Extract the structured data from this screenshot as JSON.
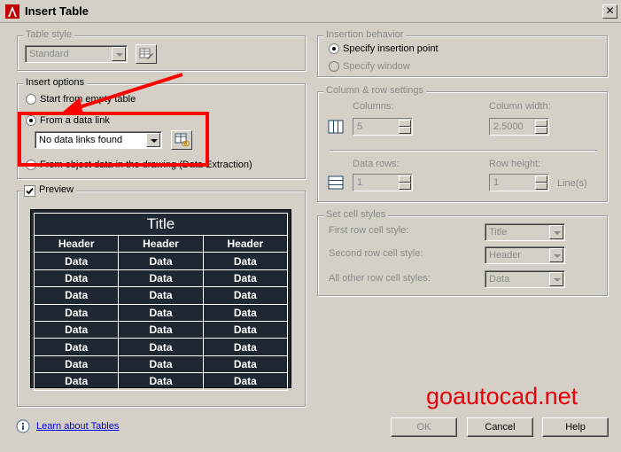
{
  "window": {
    "title": "Insert Table",
    "close_glyph": "✕"
  },
  "table_style": {
    "group_label": "Table style",
    "selected": "Standard"
  },
  "insert_options": {
    "group_label": "Insert options",
    "empty_table_label": "Start from empty table",
    "data_link_label": "From a data link",
    "data_link_selected": "No data links found",
    "object_data_label": "From object data in the drawing (Data Extraction)"
  },
  "preview": {
    "checkbox_label": "Preview",
    "checked": true,
    "title": "Title",
    "headers": [
      "Header",
      "Header",
      "Header"
    ],
    "rows": [
      [
        "Data",
        "Data",
        "Data"
      ],
      [
        "Data",
        "Data",
        "Data"
      ],
      [
        "Data",
        "Data",
        "Data"
      ],
      [
        "Data",
        "Data",
        "Data"
      ],
      [
        "Data",
        "Data",
        "Data"
      ],
      [
        "Data",
        "Data",
        "Data"
      ],
      [
        "Data",
        "Data",
        "Data"
      ],
      [
        "Data",
        "Data",
        "Data"
      ]
    ]
  },
  "insertion_behavior": {
    "group_label": "Insertion behavior",
    "point_label": "Specify insertion point",
    "window_label": "Specify window"
  },
  "column_row": {
    "group_label": "Column & row settings",
    "columns_label": "Columns:",
    "columns_value": "5",
    "column_width_label": "Column width:",
    "column_width_value": "2.5000",
    "data_rows_label": "Data rows:",
    "data_rows_value": "1",
    "row_height_label": "Row height:",
    "row_height_value": "1",
    "row_height_unit": "Line(s)"
  },
  "cell_styles": {
    "group_label": "Set cell styles",
    "first_row_label": "First row cell style:",
    "first_row_value": "Title",
    "second_row_label": "Second row cell style:",
    "second_row_value": "Header",
    "other_rows_label": "All other row cell styles:",
    "other_rows_value": "Data"
  },
  "footer": {
    "help_link": "Learn about Tables",
    "ok_label": "OK",
    "cancel_label": "Cancel",
    "help_label": "Help"
  },
  "watermark": "goautocad.net",
  "colors": {
    "annotation": "#ff0000",
    "preview_bg": "#1f2733",
    "dialog_bg": "#d4d0c8"
  }
}
